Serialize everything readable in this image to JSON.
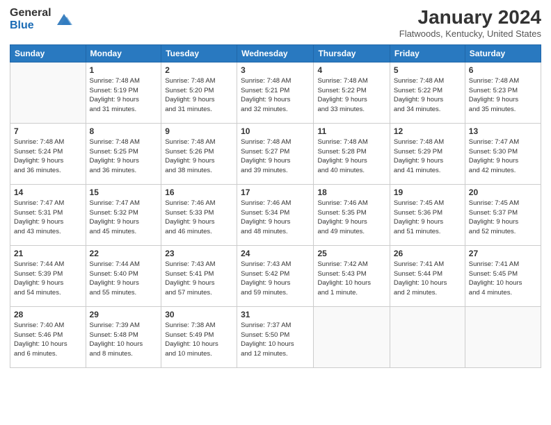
{
  "header": {
    "logo_general": "General",
    "logo_blue": "Blue",
    "month_title": "January 2024",
    "location": "Flatwoods, Kentucky, United States"
  },
  "weekdays": [
    "Sunday",
    "Monday",
    "Tuesday",
    "Wednesday",
    "Thursday",
    "Friday",
    "Saturday"
  ],
  "weeks": [
    [
      {
        "day": "",
        "info": ""
      },
      {
        "day": "1",
        "info": "Sunrise: 7:48 AM\nSunset: 5:19 PM\nDaylight: 9 hours\nand 31 minutes."
      },
      {
        "day": "2",
        "info": "Sunrise: 7:48 AM\nSunset: 5:20 PM\nDaylight: 9 hours\nand 31 minutes."
      },
      {
        "day": "3",
        "info": "Sunrise: 7:48 AM\nSunset: 5:21 PM\nDaylight: 9 hours\nand 32 minutes."
      },
      {
        "day": "4",
        "info": "Sunrise: 7:48 AM\nSunset: 5:22 PM\nDaylight: 9 hours\nand 33 minutes."
      },
      {
        "day": "5",
        "info": "Sunrise: 7:48 AM\nSunset: 5:22 PM\nDaylight: 9 hours\nand 34 minutes."
      },
      {
        "day": "6",
        "info": "Sunrise: 7:48 AM\nSunset: 5:23 PM\nDaylight: 9 hours\nand 35 minutes."
      }
    ],
    [
      {
        "day": "7",
        "info": "Sunrise: 7:48 AM\nSunset: 5:24 PM\nDaylight: 9 hours\nand 36 minutes."
      },
      {
        "day": "8",
        "info": "Sunrise: 7:48 AM\nSunset: 5:25 PM\nDaylight: 9 hours\nand 36 minutes."
      },
      {
        "day": "9",
        "info": "Sunrise: 7:48 AM\nSunset: 5:26 PM\nDaylight: 9 hours\nand 38 minutes."
      },
      {
        "day": "10",
        "info": "Sunrise: 7:48 AM\nSunset: 5:27 PM\nDaylight: 9 hours\nand 39 minutes."
      },
      {
        "day": "11",
        "info": "Sunrise: 7:48 AM\nSunset: 5:28 PM\nDaylight: 9 hours\nand 40 minutes."
      },
      {
        "day": "12",
        "info": "Sunrise: 7:48 AM\nSunset: 5:29 PM\nDaylight: 9 hours\nand 41 minutes."
      },
      {
        "day": "13",
        "info": "Sunrise: 7:47 AM\nSunset: 5:30 PM\nDaylight: 9 hours\nand 42 minutes."
      }
    ],
    [
      {
        "day": "14",
        "info": "Sunrise: 7:47 AM\nSunset: 5:31 PM\nDaylight: 9 hours\nand 43 minutes."
      },
      {
        "day": "15",
        "info": "Sunrise: 7:47 AM\nSunset: 5:32 PM\nDaylight: 9 hours\nand 45 minutes."
      },
      {
        "day": "16",
        "info": "Sunrise: 7:46 AM\nSunset: 5:33 PM\nDaylight: 9 hours\nand 46 minutes."
      },
      {
        "day": "17",
        "info": "Sunrise: 7:46 AM\nSunset: 5:34 PM\nDaylight: 9 hours\nand 48 minutes."
      },
      {
        "day": "18",
        "info": "Sunrise: 7:46 AM\nSunset: 5:35 PM\nDaylight: 9 hours\nand 49 minutes."
      },
      {
        "day": "19",
        "info": "Sunrise: 7:45 AM\nSunset: 5:36 PM\nDaylight: 9 hours\nand 51 minutes."
      },
      {
        "day": "20",
        "info": "Sunrise: 7:45 AM\nSunset: 5:37 PM\nDaylight: 9 hours\nand 52 minutes."
      }
    ],
    [
      {
        "day": "21",
        "info": "Sunrise: 7:44 AM\nSunset: 5:39 PM\nDaylight: 9 hours\nand 54 minutes."
      },
      {
        "day": "22",
        "info": "Sunrise: 7:44 AM\nSunset: 5:40 PM\nDaylight: 9 hours\nand 55 minutes."
      },
      {
        "day": "23",
        "info": "Sunrise: 7:43 AM\nSunset: 5:41 PM\nDaylight: 9 hours\nand 57 minutes."
      },
      {
        "day": "24",
        "info": "Sunrise: 7:43 AM\nSunset: 5:42 PM\nDaylight: 9 hours\nand 59 minutes."
      },
      {
        "day": "25",
        "info": "Sunrise: 7:42 AM\nSunset: 5:43 PM\nDaylight: 10 hours\nand 1 minute."
      },
      {
        "day": "26",
        "info": "Sunrise: 7:41 AM\nSunset: 5:44 PM\nDaylight: 10 hours\nand 2 minutes."
      },
      {
        "day": "27",
        "info": "Sunrise: 7:41 AM\nSunset: 5:45 PM\nDaylight: 10 hours\nand 4 minutes."
      }
    ],
    [
      {
        "day": "28",
        "info": "Sunrise: 7:40 AM\nSunset: 5:46 PM\nDaylight: 10 hours\nand 6 minutes."
      },
      {
        "day": "29",
        "info": "Sunrise: 7:39 AM\nSunset: 5:48 PM\nDaylight: 10 hours\nand 8 minutes."
      },
      {
        "day": "30",
        "info": "Sunrise: 7:38 AM\nSunset: 5:49 PM\nDaylight: 10 hours\nand 10 minutes."
      },
      {
        "day": "31",
        "info": "Sunrise: 7:37 AM\nSunset: 5:50 PM\nDaylight: 10 hours\nand 12 minutes."
      },
      {
        "day": "",
        "info": ""
      },
      {
        "day": "",
        "info": ""
      },
      {
        "day": "",
        "info": ""
      }
    ]
  ]
}
